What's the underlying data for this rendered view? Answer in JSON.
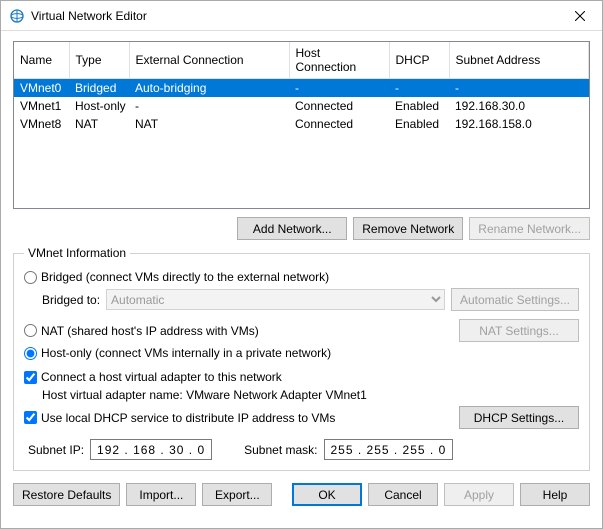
{
  "title": "Virtual Network Editor",
  "columns": [
    "Name",
    "Type",
    "External Connection",
    "Host Connection",
    "DHCP",
    "Subnet Address"
  ],
  "rows": [
    {
      "name": "VMnet0",
      "type": "Bridged",
      "ext": "Auto-bridging",
      "host": "-",
      "dhcp": "-",
      "subnet": "-",
      "selected": true
    },
    {
      "name": "VMnet1",
      "type": "Host-only",
      "ext": "-",
      "host": "Connected",
      "dhcp": "Enabled",
      "subnet": "192.168.30.0",
      "selected": false
    },
    {
      "name": "VMnet8",
      "type": "NAT",
      "ext": "NAT",
      "host": "Connected",
      "dhcp": "Enabled",
      "subnet": "192.168.158.0",
      "selected": false
    }
  ],
  "buttons": {
    "add_network": "Add Network...",
    "remove_network": "Remove Network",
    "rename_network": "Rename Network..."
  },
  "group_title": "VMnet Information",
  "radios": {
    "bridged": "Bridged (connect VMs directly to the external network)",
    "nat": "NAT (shared host's IP address with VMs)",
    "hostonly": "Host-only (connect VMs internally in a private network)"
  },
  "bridged_to_label": "Bridged to:",
  "bridged_to_value": "Automatic",
  "auto_settings": "Automatic Settings...",
  "nat_settings": "NAT Settings...",
  "check_host_adapter": "Connect a host virtual adapter to this network",
  "host_adapter_name_label": "Host virtual adapter name: VMware Network Adapter VMnet1",
  "check_dhcp": "Use local DHCP service to distribute IP address to VMs",
  "dhcp_settings": "DHCP Settings...",
  "subnet_ip_label": "Subnet IP:",
  "subnet_ip_value": "192 . 168 .  30  .   0",
  "subnet_mask_label": "Subnet mask:",
  "subnet_mask_value": "255 . 255 . 255 .   0",
  "bottom": {
    "restore": "Restore Defaults",
    "import": "Import...",
    "export": "Export...",
    "ok": "OK",
    "cancel": "Cancel",
    "apply": "Apply",
    "help": "Help"
  }
}
